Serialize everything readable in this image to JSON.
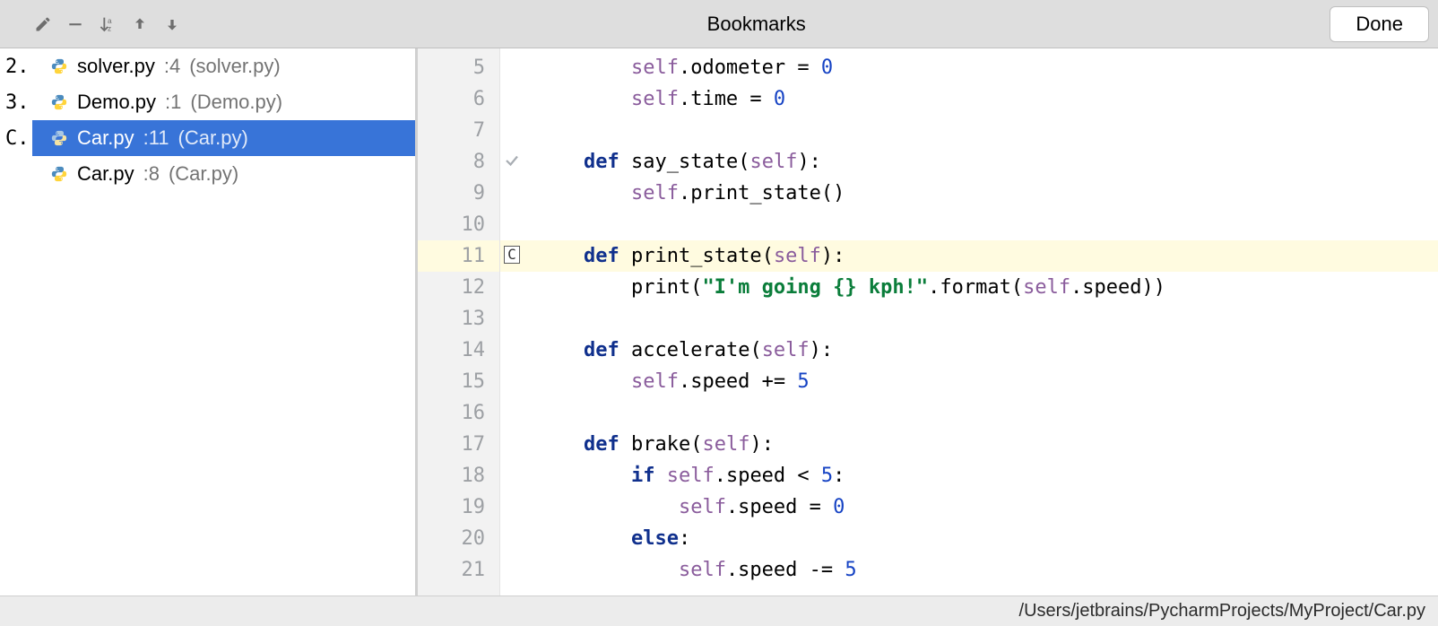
{
  "header": {
    "title": "Bookmarks",
    "done": "Done"
  },
  "bookmarks": [
    {
      "key": "2.",
      "file": "solver.py",
      "line": ":4",
      "note": "(solver.py)",
      "selected": false
    },
    {
      "key": "3.",
      "file": "Demo.py",
      "line": ":1",
      "note": "(Demo.py)",
      "selected": false
    },
    {
      "key": "C.",
      "file": "Car.py",
      "line": ":11",
      "note": "(Car.py)",
      "selected": true
    },
    {
      "key": "",
      "file": "Car.py",
      "line": ":8",
      "note": "(Car.py)",
      "selected": false
    }
  ],
  "code": {
    "lines": [
      {
        "n": "5",
        "mark": "",
        "html": "        <span class='slf'>self</span>.odometer = <span class='num'>0</span>"
      },
      {
        "n": "6",
        "mark": "",
        "html": "        <span class='slf'>self</span>.time = <span class='num'>0</span>"
      },
      {
        "n": "7",
        "mark": "",
        "html": ""
      },
      {
        "n": "8",
        "mark": "check",
        "html": "    <span class='kw'>def</span> <span class='fn'>say_state</span>(<span class='slf'>self</span>):"
      },
      {
        "n": "9",
        "mark": "",
        "html": "        <span class='slf'>self</span>.print_state()"
      },
      {
        "n": "10",
        "mark": "",
        "html": ""
      },
      {
        "n": "11",
        "mark": "C",
        "html": "    <span class='kw'>def</span> <span class='fn'>print_state</span>(<span class='slf'>self</span>):",
        "hl": true
      },
      {
        "n": "12",
        "mark": "",
        "html": "        print(<span class='str'>\"I'm going {} kph!\"</span>.format(<span class='slf'>self</span>.speed))"
      },
      {
        "n": "13",
        "mark": "",
        "html": ""
      },
      {
        "n": "14",
        "mark": "",
        "html": "    <span class='kw'>def</span> <span class='fn'>accelerate</span>(<span class='slf'>self</span>):"
      },
      {
        "n": "15",
        "mark": "",
        "html": "        <span class='slf'>self</span>.speed += <span class='num'>5</span>"
      },
      {
        "n": "16",
        "mark": "",
        "html": ""
      },
      {
        "n": "17",
        "mark": "",
        "html": "    <span class='kw'>def</span> <span class='fn'>brake</span>(<span class='slf'>self</span>):"
      },
      {
        "n": "18",
        "mark": "",
        "html": "        <span class='kw'>if</span> <span class='slf'>self</span>.speed &lt; <span class='num'>5</span>:"
      },
      {
        "n": "19",
        "mark": "",
        "html": "            <span class='slf'>self</span>.speed = <span class='num'>0</span>"
      },
      {
        "n": "20",
        "mark": "",
        "html": "        <span class='kw'>else</span>:"
      },
      {
        "n": "21",
        "mark": "",
        "html": "            <span class='slf'>self</span>.speed -= <span class='num'>5</span>"
      }
    ]
  },
  "status": {
    "path": "/Users/jetbrains/PycharmProjects/MyProject/Car.py"
  }
}
